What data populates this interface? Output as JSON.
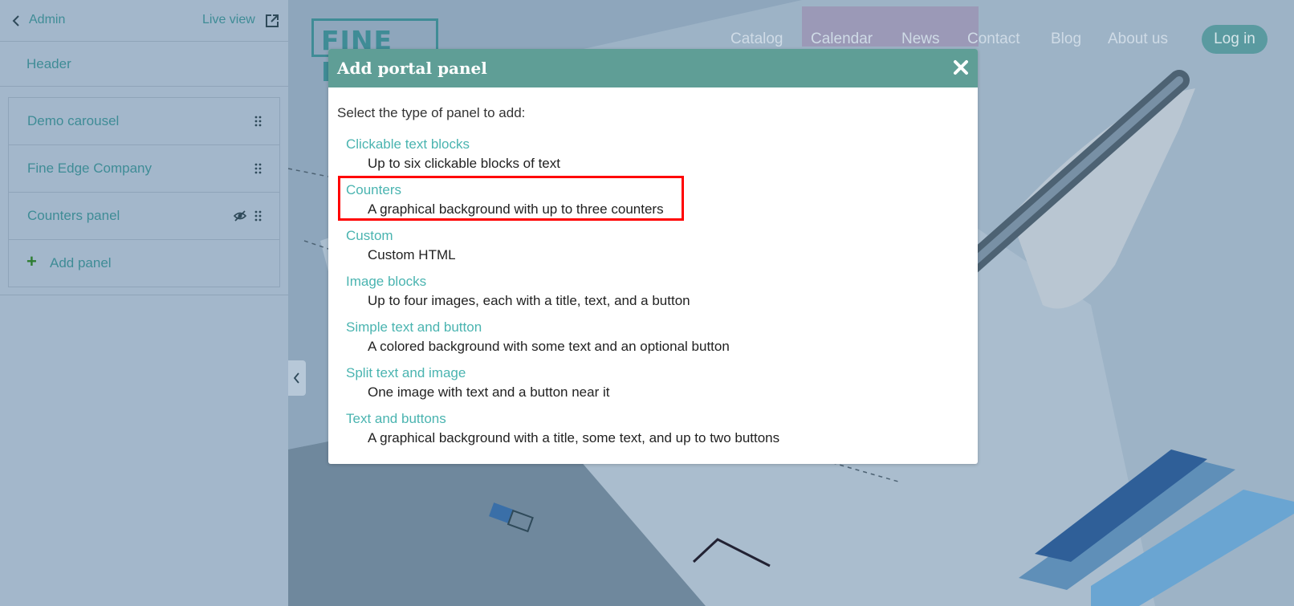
{
  "sidebar": {
    "back_label": "Admin",
    "live_view_label": "Live view",
    "header_label": "Header",
    "panels": [
      {
        "label": "Demo carousel"
      },
      {
        "label": "Fine Edge Company"
      },
      {
        "label": "Counters panel"
      }
    ],
    "add_panel_label": "Add panel"
  },
  "site": {
    "logo_text": "FINE EDGE",
    "nav": [
      "Catalog",
      "Calendar",
      "News",
      "Contact",
      "Blog",
      "About us"
    ],
    "login_label": "Log in"
  },
  "modal": {
    "title": "Add portal panel",
    "intro": "Select the type of panel to add:",
    "options": [
      {
        "title": "Clickable text blocks",
        "desc": "Up to six clickable blocks of text"
      },
      {
        "title": "Counters",
        "desc": "A graphical background with up to three counters"
      },
      {
        "title": "Custom",
        "desc": "Custom HTML"
      },
      {
        "title": "Image blocks",
        "desc": "Up to four images, each with a title, text, and a button"
      },
      {
        "title": "Simple text and button",
        "desc": "A colored background with some text and an optional button"
      },
      {
        "title": "Split text and image",
        "desc": "One image with text and a button near it"
      },
      {
        "title": "Text and buttons",
        "desc": "A graphical background with a title, some text, and up to two buttons"
      }
    ]
  },
  "colors": {
    "accent": "#3f8c96",
    "modal_header": "#5f9e96",
    "option_link": "#4ab4b0",
    "highlight": "#ff0000"
  }
}
